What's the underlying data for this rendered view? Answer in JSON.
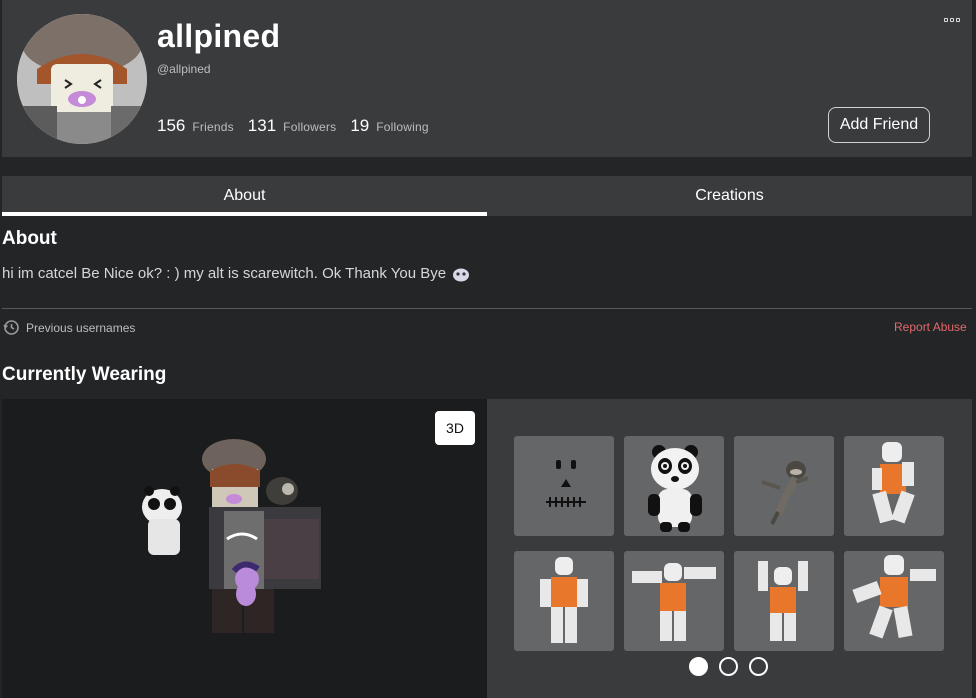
{
  "profile": {
    "display_name": "allpined",
    "username": "@allpined",
    "stats": [
      {
        "count": "156",
        "label": "Friends"
      },
      {
        "count": "131",
        "label": "Followers"
      },
      {
        "count": "19",
        "label": "Following"
      }
    ],
    "add_friend_label": "Add Friend"
  },
  "tabs": [
    {
      "label": "About",
      "active": true
    },
    {
      "label": "Creations",
      "active": false
    }
  ],
  "about": {
    "title": "About",
    "description": "hi im catcel Be Nice ok? : ) my alt is scarewitch. Ok Thank You Bye",
    "previous_usernames_label": "Previous usernames",
    "report_label": "Report Abuse"
  },
  "wearing": {
    "title": "Currently Wearing",
    "view_toggle_label": "3D",
    "items": [
      {
        "icon": "face-icon"
      },
      {
        "icon": "panda-icon"
      },
      {
        "icon": "raccoon-icon"
      },
      {
        "icon": "avatar-pose-icon"
      },
      {
        "icon": "avatar-pose-icon"
      },
      {
        "icon": "avatar-pose-icon"
      },
      {
        "icon": "avatar-pose-icon"
      },
      {
        "icon": "avatar-pose-icon"
      }
    ],
    "pagination": {
      "pages": 3,
      "current": 1
    }
  },
  "colors": {
    "page_bg": "#232527",
    "panel_bg": "#393b3d",
    "report_text": "#e2696b",
    "item_orange": "#e8762b"
  }
}
